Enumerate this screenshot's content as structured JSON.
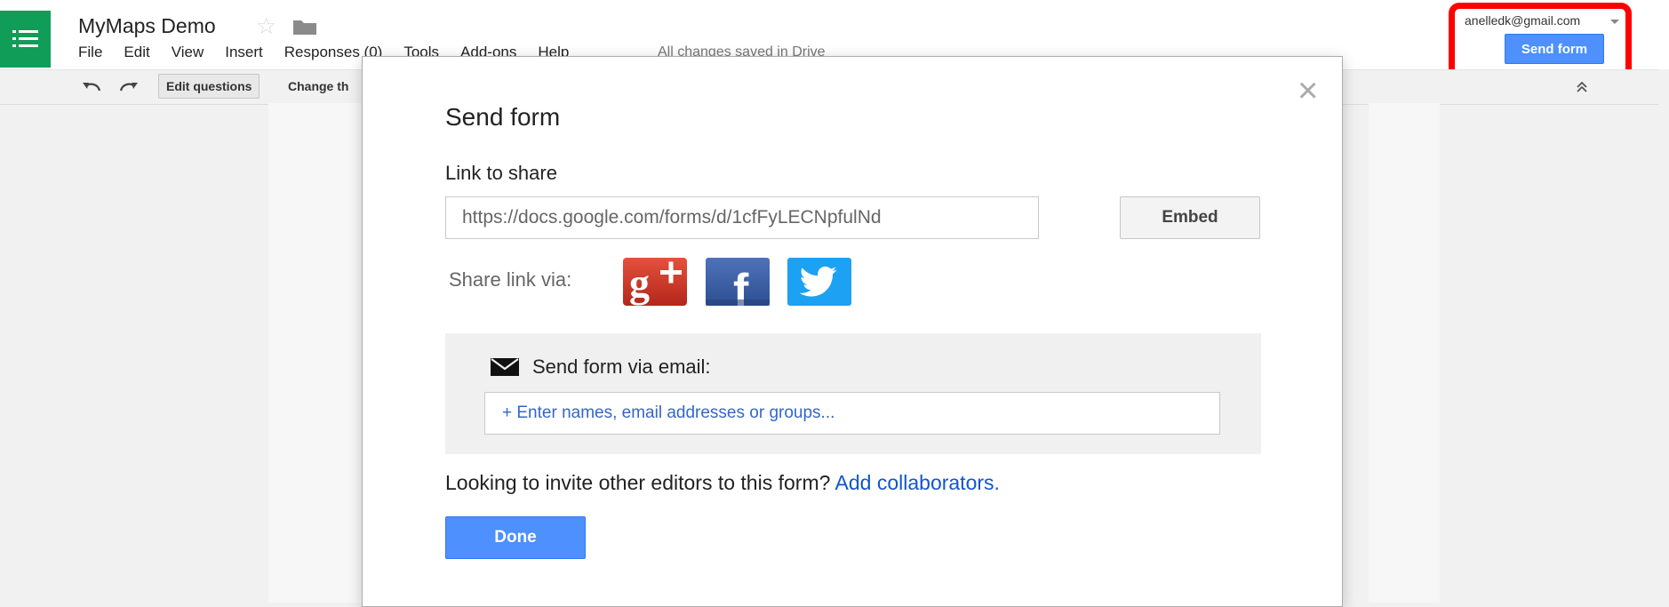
{
  "header": {
    "title": "MyMaps Demo",
    "menu": [
      "File",
      "Edit",
      "View",
      "Insert",
      "Responses (0)",
      "Tools",
      "Add-ons",
      "Help"
    ],
    "save_status": "All changes saved in Drive",
    "user_email": "anelledk@gmail.com",
    "send_form_label": "Send form",
    "highlight_color": "#ff0000"
  },
  "toolbar": {
    "edit_questions_label": "Edit questions",
    "change_theme_label": "Change th"
  },
  "dialog": {
    "title": "Send form",
    "link_label": "Link to share",
    "link_value": "https://docs.google.com/forms/d/1cfFyLECNpfulNd",
    "embed_label": "Embed",
    "share_via_label": "Share link via:",
    "social_icons": [
      "google-plus-icon",
      "facebook-icon",
      "twitter-icon"
    ],
    "email_label": "Send form via email:",
    "email_placeholder": "+ Enter names, email addresses or groups...",
    "invite_text": "Looking to invite other editors to this form?",
    "invite_link": "Add collaborators.",
    "done_label": "Done"
  },
  "colors": {
    "accent": "#4d90fe",
    "app_green": "#0f9d58",
    "link": "#1155cc"
  }
}
